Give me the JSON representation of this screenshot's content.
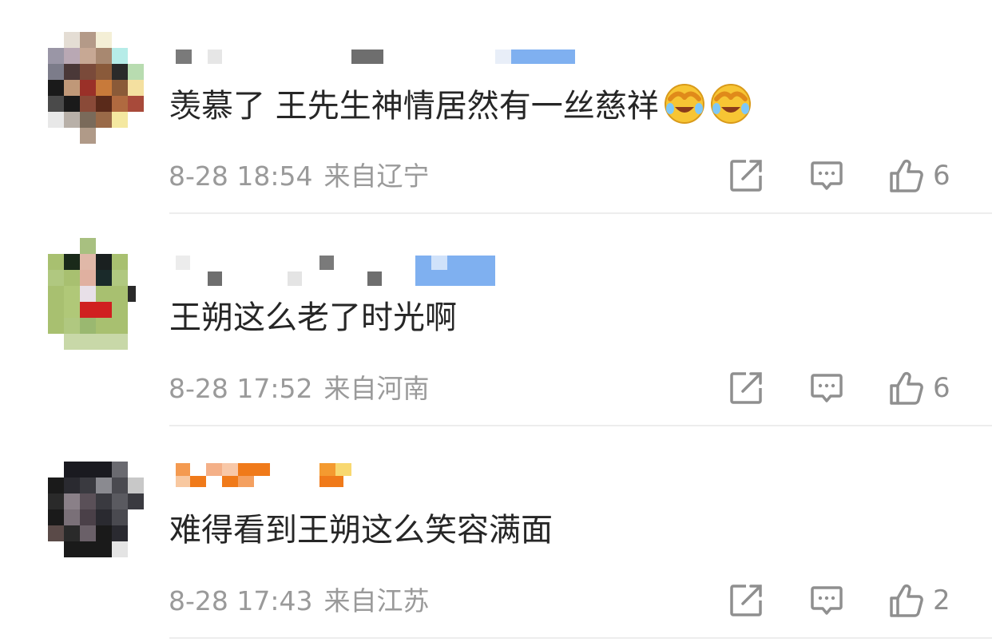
{
  "comments": [
    {
      "text": "羡慕了 王先生神情居然有一丝慈祥",
      "emojis": [
        "laughing-crying-emoji",
        "laughing-crying-emoji"
      ],
      "time": "8-28 18:54",
      "location": "来自辽宁",
      "likes": "6"
    },
    {
      "text": "王朔这么老了时光啊",
      "emojis": [],
      "time": "8-28 17:52",
      "location": "来自河南",
      "likes": "6"
    },
    {
      "text": "难得看到王朔这么笑容满面",
      "emojis": [],
      "time": "8-28 17:43",
      "location": "来自江苏",
      "likes": "2"
    }
  ],
  "icons": {
    "share": "share-icon",
    "reply": "comment-icon",
    "like": "thumbs-up-icon"
  },
  "colors": {
    "text": "#262626",
    "meta": "#9a9a9a",
    "icon": "#8f8f8f",
    "divider": "#ededed",
    "username_blurred_blue": "#7fb0f0",
    "username_blurred_orange": "#f07a1a"
  }
}
